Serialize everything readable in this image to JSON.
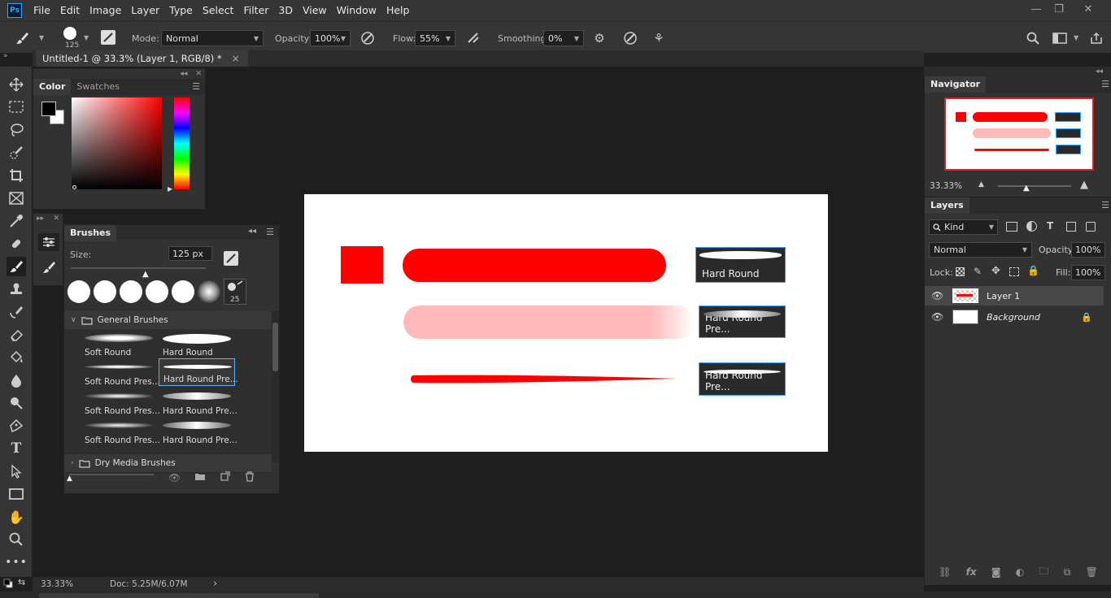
{
  "app": {
    "logo": "Ps"
  },
  "menu": [
    "File",
    "Edit",
    "Image",
    "Layer",
    "Type",
    "Select",
    "Filter",
    "3D",
    "View",
    "Window",
    "Help"
  ],
  "window_controls": {
    "minimize": "—",
    "restore": "❐",
    "close": "✕"
  },
  "options": {
    "brush_size": "125",
    "mode_label": "Mode:",
    "mode_value": "Normal",
    "opacity_label": "Opacity:",
    "opacity_value": "100%",
    "flow_label": "Flow:",
    "flow_value": "55%",
    "smoothing_label": "Smoothing:",
    "smoothing_value": "0%"
  },
  "document_tab": {
    "title": "Untitled-1 @ 33.3% (Layer 1, RGB/8) *",
    "close": "×"
  },
  "color_panel": {
    "tabs": [
      "Color",
      "Swatches"
    ],
    "foreground": "#000000",
    "background": "#ffffff"
  },
  "brushes_panel": {
    "title": "Brushes",
    "size_label": "Size:",
    "size_value": "125 px",
    "preset_count": "25",
    "groups": [
      {
        "name": "General Brushes"
      },
      {
        "name": "Dry Media Brushes"
      }
    ],
    "brushes": [
      {
        "label": "Soft Round"
      },
      {
        "label": "Hard Round"
      },
      {
        "label": "Soft Round Pres..."
      },
      {
        "label": "Hard Round Pre..."
      },
      {
        "label": "Soft Round Pres..."
      },
      {
        "label": "Hard Round Pre..."
      },
      {
        "label": "Soft Round Pres..."
      },
      {
        "label": "Hard Round Pre..."
      }
    ]
  },
  "canvas_samples": [
    {
      "label": "Hard Round"
    },
    {
      "label": "Hard Round Pre..."
    },
    {
      "label": "Hard Round Pre..."
    }
  ],
  "paint_color": "#ff0000",
  "status": {
    "zoom": "33.33%",
    "doc": "Doc: 5.25M/6.07M",
    "arrow": "›"
  },
  "navigator": {
    "title": "Navigator",
    "zoom": "33.33%"
  },
  "layers_panel": {
    "title": "Layers",
    "filter": "Kind",
    "blend_mode": "Normal",
    "opacity_label": "Opacity:",
    "opacity_value": "100%",
    "lock_label": "Lock:",
    "fill_label": "Fill:",
    "fill_value": "100%",
    "layers": [
      {
        "name": "Layer 1"
      },
      {
        "name": "Background"
      }
    ]
  }
}
